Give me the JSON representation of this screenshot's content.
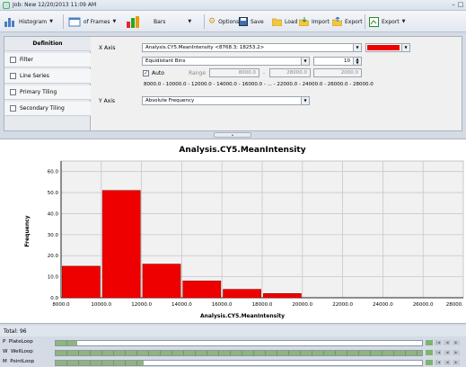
{
  "window": {
    "title": "Job: New 12/20/2013 11:09 AM"
  },
  "toolbar": {
    "visualization": "Histogram",
    "frames": "of Frames",
    "bars": "Bars",
    "options": "Options",
    "save": "Save",
    "load": "Load",
    "import": "Import",
    "export1": "Export",
    "export2": "Export"
  },
  "definition": {
    "header": "Definition",
    "tabs": [
      "Filter",
      "Line Series",
      "Primary Tiling",
      "Secondary Tiling"
    ],
    "x_axis_label": "X Axis",
    "x_axis_value": "Analysis.CY5.MeanIntensity <8768.3; 18253.2>",
    "swatch_color": "#ee0000",
    "binning": "Equidistant Bins",
    "bins": "10",
    "auto_label": "Auto",
    "range_label": "Range",
    "range_min": "8000.0",
    "range_dash": "-",
    "range_max": "28000.0",
    "step": "2000.0",
    "bin_edges": "8000.0 - 10000.0 - 12000.0 - 14000.0 - 16000.0 - ... - 22000.0 - 24000.0 - 26000.0 - 28000.0",
    "y_axis_label": "Y Axis",
    "y_axis_value": "Absolute Frequency"
  },
  "chart_data": {
    "type": "bar",
    "title": "Analysis.CY5.MeanIntensity",
    "xlabel": "Analysis.CY5.MeanIntensity",
    "ylabel": "Frequency",
    "bin_edges": [
      8000,
      10000,
      12000,
      14000,
      16000,
      18000,
      20000,
      22000,
      24000,
      26000,
      28000
    ],
    "values": [
      15,
      51,
      16,
      8,
      4,
      2,
      0,
      0,
      0,
      0
    ],
    "xlim": [
      8000,
      28000
    ],
    "ylim": [
      0,
      65
    ],
    "xticks": [
      8000,
      10000,
      12000,
      14000,
      16000,
      18000,
      20000,
      22000,
      24000,
      26000,
      28000
    ],
    "xtick_labels": [
      "8000.0",
      "10000.0",
      "12000.0",
      "14000.0",
      "16000.0",
      "18000.0",
      "20000.0",
      "22000.0",
      "24000.0",
      "26000.0",
      "28000."
    ],
    "yticks": [
      0,
      10,
      20,
      30,
      40,
      50,
      60
    ],
    "ytick_labels": [
      "0.0",
      "10.0",
      "20.0",
      "30.0",
      "40.0",
      "50.0",
      "60.0"
    ],
    "bar_color": "#ee0000",
    "grid": true
  },
  "status": {
    "total": "Total: 96"
  },
  "loops": [
    {
      "prefix": "P",
      "name": "PlateLoop",
      "progress": 0.06
    },
    {
      "prefix": "W",
      "name": "WellLoop",
      "progress": 1.0
    },
    {
      "prefix": "M",
      "name": "PointLoop",
      "progress": 0.24
    }
  ]
}
